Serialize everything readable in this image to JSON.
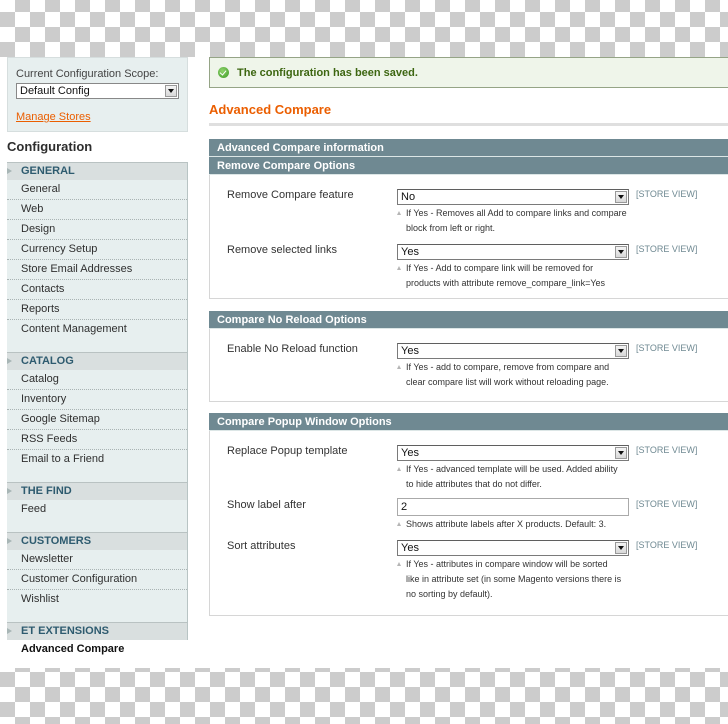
{
  "sidebar": {
    "scope_label": "Current Configuration Scope:",
    "scope_value": "Default Config",
    "manage_stores": "Manage Stores",
    "config_title": "Configuration",
    "groups": [
      {
        "title": "GENERAL",
        "items": [
          "General",
          "Web",
          "Design",
          "Currency Setup",
          "Store Email Addresses",
          "Contacts",
          "Reports",
          "Content Management"
        ]
      },
      {
        "title": "CATALOG",
        "items": [
          "Catalog",
          "Inventory",
          "Google Sitemap",
          "RSS Feeds",
          "Email to a Friend"
        ]
      },
      {
        "title": "THE FIND",
        "items": [
          "Feed"
        ]
      },
      {
        "title": "CUSTOMERS",
        "items": [
          "Newsletter",
          "Customer Configuration",
          "Wishlist"
        ]
      },
      {
        "title": "ET EXTENSIONS",
        "items": [
          "Advanced Compare"
        ]
      }
    ]
  },
  "main": {
    "success_message": "The configuration has been saved.",
    "page_title": "Advanced Compare",
    "sections": [
      {
        "title": "Advanced Compare information",
        "fields": []
      },
      {
        "title": "Remove Compare Options",
        "fields": [
          {
            "label": "Remove Compare feature",
            "type": "select",
            "value": "No",
            "scope": "[STORE VIEW]",
            "note": [
              "If Yes - Removes all Add to compare links and compare",
              "block from left or right."
            ]
          },
          {
            "label": "Remove selected links",
            "type": "select",
            "value": "Yes",
            "scope": "[STORE VIEW]",
            "note": [
              "If Yes - Add to compare link will be removed for",
              "products with attribute remove_compare_link=Yes"
            ]
          }
        ]
      },
      {
        "title": "Compare No Reload Options",
        "fields": [
          {
            "label": "Enable No Reload function",
            "type": "select",
            "value": "Yes",
            "scope": "[STORE VIEW]",
            "note": [
              "If Yes - add to compare, remove from compare and",
              "clear compare list will work without reloading page."
            ]
          }
        ]
      },
      {
        "title": "Compare Popup Window Options",
        "fields": [
          {
            "label": "Replace Popup template",
            "type": "select",
            "value": "Yes",
            "scope": "[STORE VIEW]",
            "note": [
              "If Yes - advanced template will be used. Added ability",
              "to hide attributes that do not differ."
            ]
          },
          {
            "label": "Show label after",
            "type": "text",
            "value": "2",
            "scope": "[STORE VIEW]",
            "note": [
              "Shows attribute labels after X products. Default: 3."
            ]
          },
          {
            "label": "Sort attributes",
            "type": "select",
            "value": "Yes",
            "scope": "[STORE VIEW]",
            "note": [
              "If Yes - attributes in compare window will be sorted",
              "like in attribute set (in some Magento versions there is",
              "no sorting by default)."
            ]
          }
        ]
      }
    ]
  }
}
